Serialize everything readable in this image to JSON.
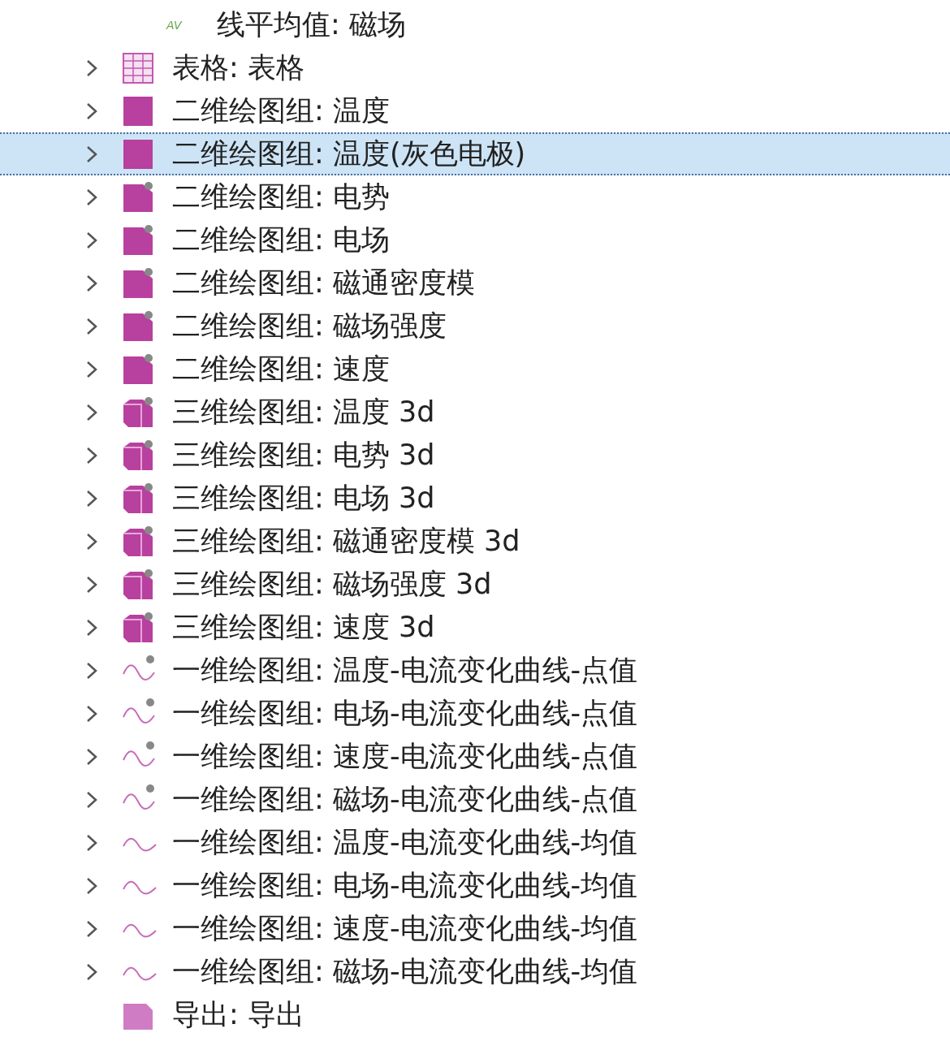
{
  "tree": {
    "hidden_parent_children": [
      {
        "kind": "average",
        "icon_text": "AV",
        "label": "线平均值: 磁场",
        "expandable": false,
        "selected": false
      }
    ],
    "items": [
      {
        "kind": "table",
        "label": "表格: 表格",
        "expandable": true,
        "selected": false
      },
      {
        "kind": "plot2d",
        "label": "二维绘图组: 温度",
        "expandable": true,
        "selected": false
      },
      {
        "kind": "plot2d",
        "label": "二维绘图组: 温度(灰色电极)",
        "expandable": true,
        "selected": true
      },
      {
        "kind": "plot2d_gear",
        "label": "二维绘图组: 电势",
        "expandable": true,
        "selected": false
      },
      {
        "kind": "plot2d_gear",
        "label": "二维绘图组: 电场",
        "expandable": true,
        "selected": false
      },
      {
        "kind": "plot2d_gear",
        "label": "二维绘图组: 磁通密度模",
        "expandable": true,
        "selected": false
      },
      {
        "kind": "plot2d_gear",
        "label": "二维绘图组: 磁场强度",
        "expandable": true,
        "selected": false
      },
      {
        "kind": "plot2d_gear",
        "label": "二维绘图组: 速度",
        "expandable": true,
        "selected": false
      },
      {
        "kind": "plot3d",
        "label": "三维绘图组: 温度 3d",
        "expandable": true,
        "selected": false
      },
      {
        "kind": "plot3d",
        "label": "三维绘图组: 电势 3d",
        "expandable": true,
        "selected": false
      },
      {
        "kind": "plot3d",
        "label": "三维绘图组: 电场 3d",
        "expandable": true,
        "selected": false
      },
      {
        "kind": "plot3d",
        "label": "三维绘图组: 磁通密度模 3d",
        "expandable": true,
        "selected": false
      },
      {
        "kind": "plot3d",
        "label": "三维绘图组: 磁场强度 3d",
        "expandable": true,
        "selected": false
      },
      {
        "kind": "plot3d",
        "label": "三维绘图组: 速度 3d",
        "expandable": true,
        "selected": false
      },
      {
        "kind": "plot1d_gear",
        "label": "一维绘图组: 温度-电流变化曲线-点值",
        "expandable": true,
        "selected": false
      },
      {
        "kind": "plot1d_gear",
        "label": "一维绘图组: 电场-电流变化曲线-点值",
        "expandable": true,
        "selected": false
      },
      {
        "kind": "plot1d_gear",
        "label": "一维绘图组: 速度-电流变化曲线-点值",
        "expandable": true,
        "selected": false
      },
      {
        "kind": "plot1d_gear",
        "label": "一维绘图组: 磁场-电流变化曲线-点值",
        "expandable": true,
        "selected": false
      },
      {
        "kind": "plot1d",
        "label": "一维绘图组: 温度-电流变化曲线-均值",
        "expandable": true,
        "selected": false
      },
      {
        "kind": "plot1d",
        "label": "一维绘图组: 电场-电流变化曲线-均值",
        "expandable": true,
        "selected": false
      },
      {
        "kind": "plot1d",
        "label": "一维绘图组: 速度-电流变化曲线-均值",
        "expandable": true,
        "selected": false
      },
      {
        "kind": "plot1d",
        "label": "一维绘图组: 磁场-电流变化曲线-均值",
        "expandable": true,
        "selected": false
      },
      {
        "kind": "export",
        "label": "导出: 导出",
        "expandable": false,
        "selected": false
      }
    ]
  }
}
